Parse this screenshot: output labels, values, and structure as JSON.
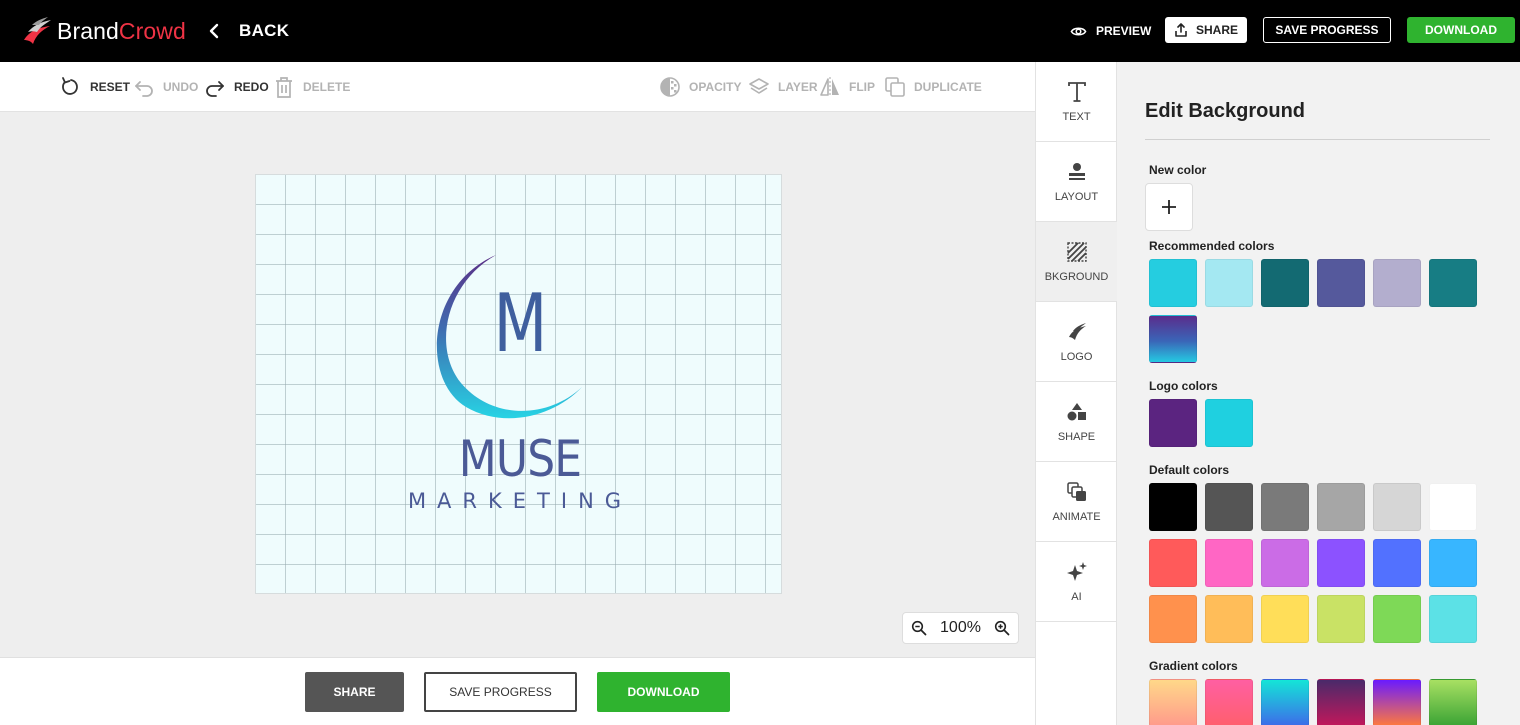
{
  "brand": {
    "name_a": "Brand",
    "name_b": "Crowd"
  },
  "header": {
    "back_label": "BACK",
    "preview_label": "PREVIEW",
    "share_label": "SHARE",
    "save_label": "SAVE PROGRESS",
    "download_label": "DOWNLOAD"
  },
  "toolbar": {
    "reset": "RESET",
    "undo": "UNDO",
    "redo": "REDO",
    "delete": "DELETE",
    "opacity": "OPACITY",
    "layer": "LAYER",
    "flip": "FLIP",
    "duplicate": "DUPLICATE"
  },
  "design": {
    "monogram": "M",
    "name": "MUSE",
    "tagline": "MARKETING"
  },
  "zoom": {
    "level": "100%"
  },
  "bottombar": {
    "share_label": "SHARE",
    "save_label": "SAVE PROGRESS",
    "download_label": "DOWNLOAD"
  },
  "rail": {
    "items": [
      {
        "label": "TEXT",
        "icon": "text-icon"
      },
      {
        "label": "LAYOUT",
        "icon": "layout-icon"
      },
      {
        "label": "BKGROUND",
        "icon": "background-icon",
        "active": true
      },
      {
        "label": "LOGO",
        "icon": "logo-icon"
      },
      {
        "label": "SHAPE",
        "icon": "shape-icon"
      },
      {
        "label": "ANIMATE",
        "icon": "animate-icon"
      },
      {
        "label": "AI",
        "icon": "ai-sparkle-icon"
      }
    ]
  },
  "panel": {
    "title": "Edit Background",
    "new_color_label": "New color",
    "recommended_label": "Recommended colors",
    "logo_colors_label": "Logo colors",
    "default_label": "Default colors",
    "gradient_label": "Gradient colors",
    "recommended": [
      "#25cde0",
      "#a4e8f2",
      "#136a72",
      "#55599c",
      "#b3aece",
      "#177d84",
      "linear-gradient(180deg,#5a2d8c 0%,#3a66b8 55%,#25c9e2 100%)"
    ],
    "logo_colors": [
      "#5b2480",
      "#1fd0e0"
    ],
    "default_colors": [
      "#000000",
      "#555555",
      "#7a7a7a",
      "#a6a6a6",
      "#d6d6d6",
      "#ffffff",
      "#ff5a5a",
      "#ff66c4",
      "#cb6ce6",
      "#8c52ff",
      "#5271ff",
      "#38b6ff",
      "#ff914d",
      "#ffbd59",
      "#ffde59",
      "#c9e265",
      "#7ed957",
      "#5ce1e6"
    ],
    "gradient_colors": [
      "linear-gradient(180deg,#ffd889,#ff9a8b)",
      "linear-gradient(180deg,#ff5fa2,#ff5f6d)",
      "linear-gradient(180deg,#14e5d7,#3d6be9)",
      "linear-gradient(180deg,#4a2a6a,#c2185b)",
      "linear-gradient(180deg,#6a1bff,#ff7a3d)",
      "linear-gradient(180deg,#a8e063,#3aa335)"
    ]
  }
}
